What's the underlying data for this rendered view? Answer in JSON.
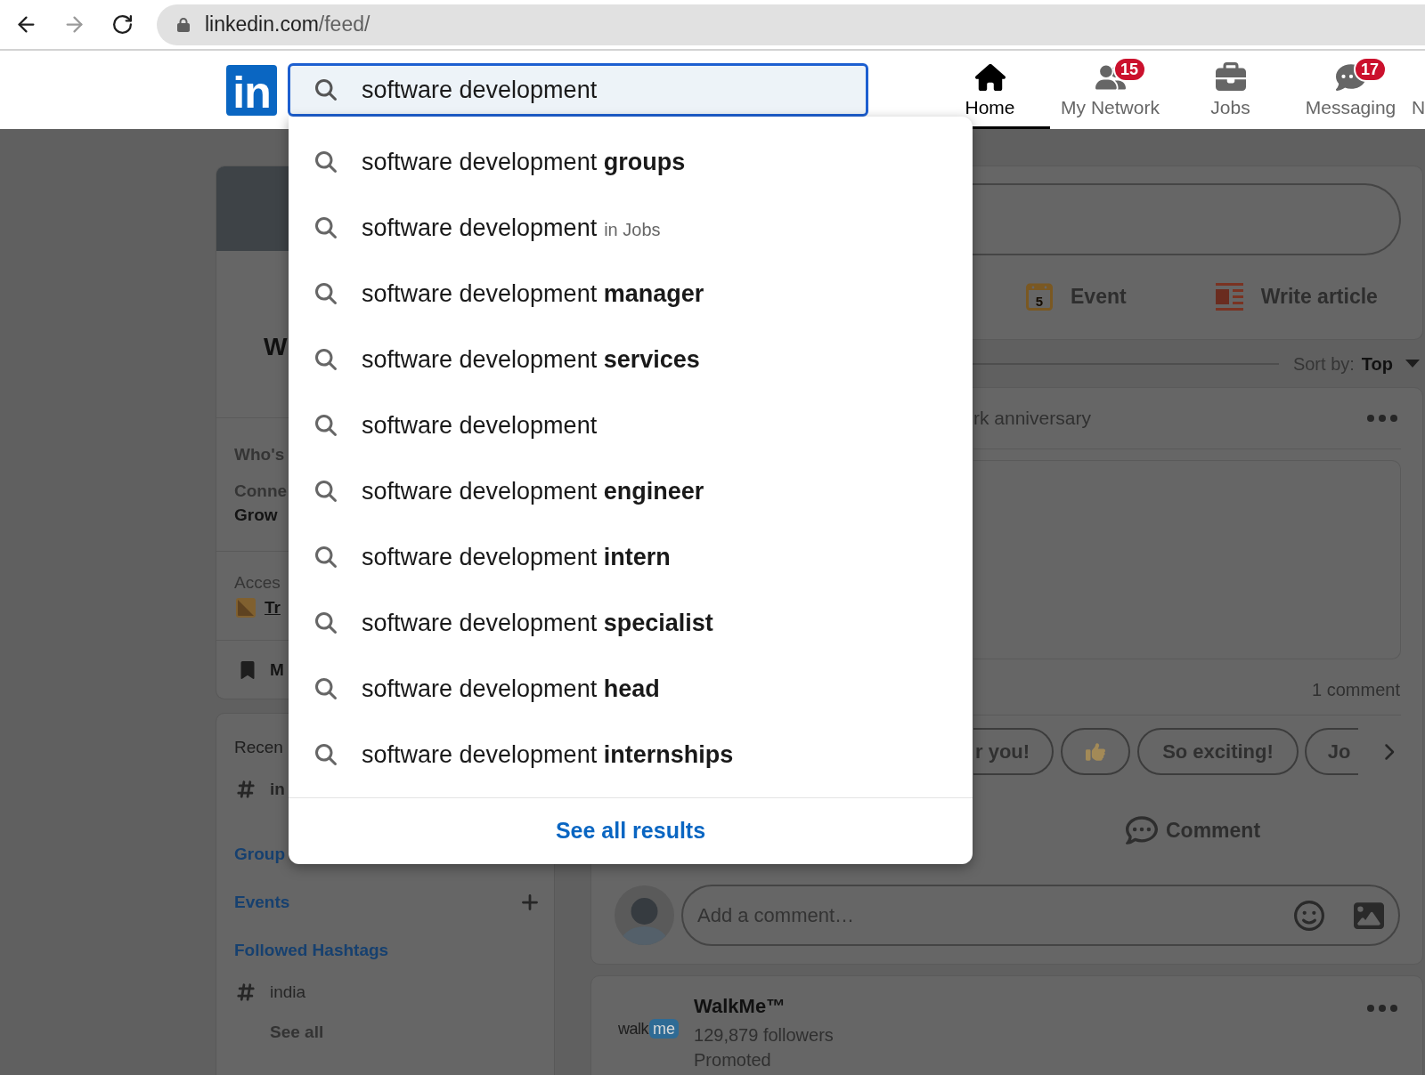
{
  "browser": {
    "url_host": "linkedin.com",
    "url_path": "/feed/"
  },
  "header": {
    "logo": "in",
    "search": {
      "value": "software development"
    },
    "nav": [
      {
        "label": "Home",
        "selected": true
      },
      {
        "label": "My Network",
        "selected": false,
        "badge": "15"
      },
      {
        "label": "Jobs",
        "selected": false
      },
      {
        "label": "Messaging",
        "selected": false,
        "badge": "17"
      },
      {
        "label": "N",
        "selected": false
      }
    ]
  },
  "search_dropdown": {
    "suggestions": [
      {
        "text": "software development **groups**"
      },
      {
        "text": "software development",
        "scope": "in Jobs"
      },
      {
        "text": "software development **manager**"
      },
      {
        "text": "software development **services**"
      },
      {
        "text": "software development"
      },
      {
        "text": "software development **engineer**"
      },
      {
        "text": "software development **intern**"
      },
      {
        "text": "software development **specialist**"
      },
      {
        "text": "software development **head**"
      },
      {
        "text": "software development **internships**"
      }
    ],
    "see_all": "See all results"
  },
  "sidebar": {
    "profile_card": {
      "name": "W",
      "viewers_label": "Who's",
      "connections_label": "Conne",
      "connections_hint": "Grow",
      "premium_label": "Acces",
      "premium_link": "Tr",
      "saved_link": "M"
    },
    "community_card": {
      "recent_label": "Recen",
      "recent": [
        {
          "tag": "in"
        }
      ],
      "groups_link": "Group",
      "events_link": "Events",
      "hashtags_link": "Followed Hashtags",
      "hashtags": [
        {
          "tag": "india"
        }
      ],
      "see_all": "See all"
    }
  },
  "feed": {
    "share_box": {
      "actions": [
        "Event",
        "Write article"
      ],
      "calendar_day": "5"
    },
    "sort": {
      "label": "Sort by:",
      "value": "Top"
    },
    "post": {
      "header": "rk anniversary",
      "comment_count": "1 comment",
      "quick_replies": [
        {
          "kind": "text",
          "label": "r you!"
        },
        {
          "kind": "emoji"
        },
        {
          "kind": "text",
          "label": "So exciting!"
        },
        {
          "kind": "text",
          "label": "Jo"
        }
      ],
      "comment_action": "Comment",
      "comment_placeholder": "Add a comment…"
    },
    "ad": {
      "logo_word": "walk",
      "logo_bubble": "me",
      "company": "WalkMe™",
      "followers": "129,879 followers",
      "label": "Promoted"
    }
  }
}
